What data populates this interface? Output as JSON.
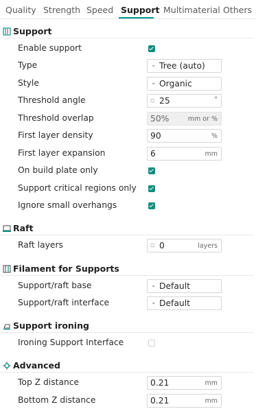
{
  "tabs": [
    "Quality",
    "Strength",
    "Speed",
    "Support",
    "Multimaterial",
    "Others"
  ],
  "accent_color": "#009688",
  "checkbox_color": "#0c8f7e",
  "sections": {
    "support": {
      "title": "Support",
      "icon": "support-icon",
      "enable_support": {
        "label": "Enable support",
        "checked": true
      },
      "type": {
        "label": "Type",
        "value": "Tree (auto)"
      },
      "style": {
        "label": "Style",
        "value": "Organic"
      },
      "threshold_angle": {
        "label": "Threshold angle",
        "value": "25",
        "unit": "°"
      },
      "threshold_overlap": {
        "label": "Threshold overlap",
        "value": "50%",
        "unit": "mm or %"
      },
      "first_layer_density": {
        "label": "First layer density",
        "value": "90",
        "unit": "%"
      },
      "first_layer_expansion": {
        "label": "First layer expansion",
        "value": "6",
        "unit": "mm"
      },
      "on_build_plate_only": {
        "label": "On build plate only",
        "checked": true
      },
      "critical_regions_only": {
        "label": "Support critical regions only",
        "checked": true
      },
      "ignore_small_overhangs": {
        "label": "Ignore small overhangs",
        "checked": true
      }
    },
    "raft": {
      "title": "Raft",
      "icon": "raft-icon",
      "raft_layers": {
        "label": "Raft layers",
        "value": "0",
        "unit": "layers"
      }
    },
    "filament": {
      "title": "Filament for Supports",
      "icon": "filament-icon",
      "base": {
        "label": "Support/raft base",
        "value": "Default"
      },
      "interface": {
        "label": "Support/raft interface",
        "value": "Default"
      }
    },
    "ironing": {
      "title": "Support ironing",
      "icon": "ironing-icon",
      "ironing_interface": {
        "label": "Ironing Support Interface",
        "checked": false
      }
    },
    "advanced": {
      "title": "Advanced",
      "icon": "advanced-icon",
      "top_z": {
        "label": "Top Z distance",
        "value": "0.21",
        "unit": "mm"
      },
      "bottom_z": {
        "label": "Bottom Z distance",
        "value": "0.21",
        "unit": "mm"
      }
    }
  }
}
